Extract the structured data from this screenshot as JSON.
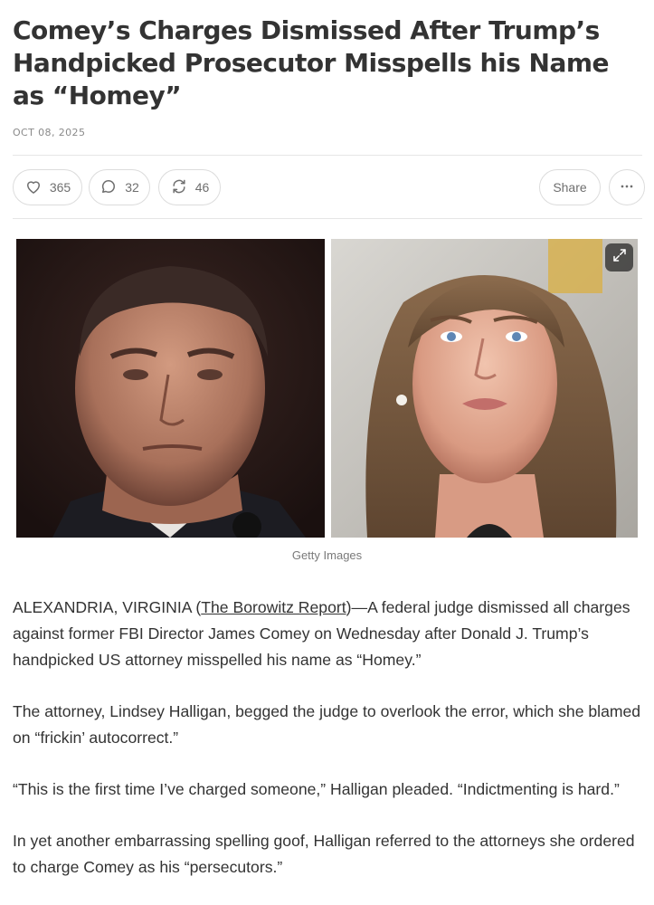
{
  "article": {
    "title": "Comey’s Charges Dismissed After Trump’s Handpicked Prosecutor Misspells his Name as “Homey”",
    "date": "OCT 08, 2025"
  },
  "actions": {
    "likes": "365",
    "comments": "32",
    "restacks": "46",
    "share_label": "Share",
    "more_icon": "ellipsis-icon"
  },
  "image": {
    "caption": "Getty Images",
    "expand_icon": "expand-icon"
  },
  "body": {
    "p1_prefix": "ALEXANDRIA, VIRGINIA (",
    "p1_link": "The Borowitz Report",
    "p1_rest": ")—A federal judge dismissed all charges against former FBI Director James Comey on Wednesday after Donald J. Trump’s handpicked US attorney misspelled his name as “Homey.”",
    "p2": "The attorney, Lindsey Halligan, begged the judge to overlook the error, which she blamed on “frickin’ autocorrect.”",
    "p3": "“This is the first time I’ve charged someone,” Halligan pleaded. “Indictmenting is hard.”",
    "p4": "In yet another embarrassing spelling goof, Halligan referred to the attorneys she ordered to charge Comey as his “persecutors.”"
  },
  "colors": {
    "text": "#333333",
    "muted": "#8a8a8a",
    "border": "#dcdcdc"
  }
}
